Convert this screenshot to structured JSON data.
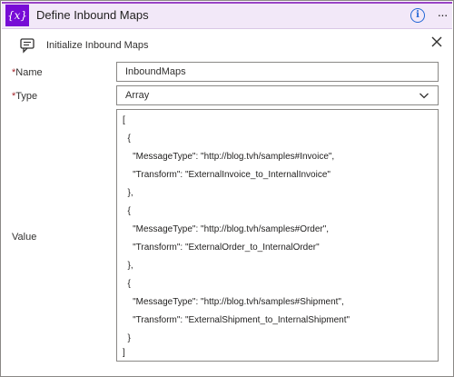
{
  "header": {
    "icon_text": "{x}",
    "title": "Define Inbound Maps",
    "info_icon": "info-icon",
    "more_icon": "more-options-icon",
    "accent_color": "#770bd6"
  },
  "action": {
    "icon": "comment-icon",
    "title": "Initialize Inbound Maps",
    "close_icon": "close-icon"
  },
  "fields": {
    "name_label": "Name",
    "name_value": "InboundMaps",
    "type_label": "Type",
    "type_value": "Array",
    "value_label": "Value",
    "required_marker": "*"
  },
  "value_lines": [
    "[",
    "  {",
    "    \"MessageType\": \"http://blog.tvh/samples#Invoice\",",
    "    \"Transform\": \"ExternalInvoice_to_InternalInvoice\"",
    "  },",
    "  {",
    "    \"MessageType\": \"http://blog.tvh/samples#Order\",",
    "    \"Transform\": \"ExternalOrder_to_InternalOrder\"",
    "  },",
    "  {",
    "    \"MessageType\": \"http://blog.tvh/samples#Shipment\",",
    "    \"Transform\": \"ExternalShipment_to_InternalShipment\"",
    "  }",
    "]"
  ]
}
